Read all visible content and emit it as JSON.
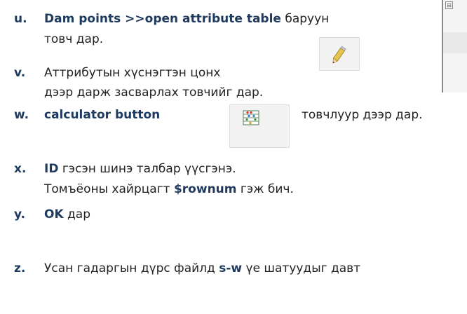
{
  "items": [
    {
      "marker": "u.",
      "lines": [
        {
          "bold": "Dam points >>open attribute table",
          "rest": " баруун"
        },
        {
          "text": "товч дар."
        }
      ]
    },
    {
      "marker": "v.",
      "lines": [
        {
          "text": "Аттрибутын хүснэгтэн цонх"
        },
        {
          "text": "дээр дарж засварлах товчийг дар."
        }
      ]
    },
    {
      "marker": "w.",
      "lines": [
        {
          "bold": "calculator button",
          "rest": "товчлуур дээр дар."
        }
      ]
    },
    {
      "marker": "x.",
      "lines": [
        {
          "bold": "ID",
          "rest": " гэсэн шинэ талбар үүсгэнэ."
        },
        {
          "pre": "Томъёоны хайрцагт ",
          "bold": "$rownum",
          "rest": " гэж бич."
        }
      ]
    },
    {
      "marker": "y.",
      "lines": [
        {
          "bold": "OK",
          "rest": " дар"
        }
      ]
    },
    {
      "marker": "z.",
      "lines": [
        {
          "pre": "Усан гадаргын дүрс файлд ",
          "bold": "s-w",
          "rest": " үе шатуудыг давт"
        }
      ]
    }
  ],
  "icons": {
    "edit": "pencil-icon",
    "calculator": "field-calculator-icon",
    "collapse": "⊟"
  },
  "colors": {
    "marker": "#1e3a5f",
    "text": "#222222",
    "icon_bg": "#f2f2f2"
  }
}
